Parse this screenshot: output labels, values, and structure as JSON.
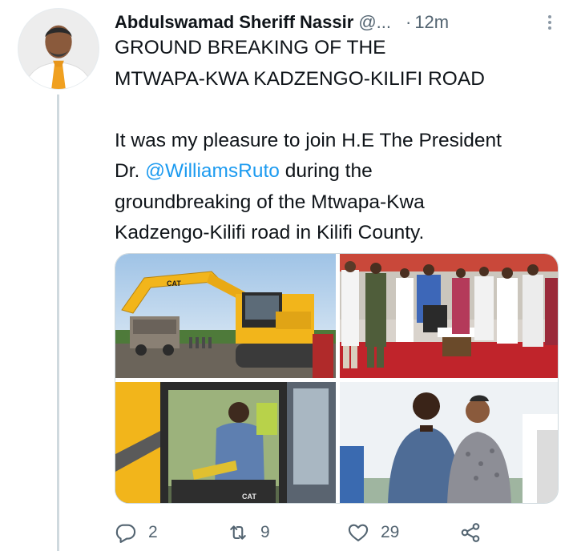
{
  "tweet": {
    "author_name": "Abdulswamad Sheriff Nassir",
    "author_handle": "@...",
    "separator": "·",
    "time": "12m",
    "title_line1": "GROUND BREAKING OF THE",
    "title_line2": "MTWAPA-KWA KADZENGO-KILIFI ROAD",
    "body_line1": "It was my pleasure to join H.E The President",
    "body_line2_pre": "Dr. ",
    "body_mention": "@WilliamsRuto",
    "body_line2_post": " during the",
    "body_line3": "groundbreaking of the Mtwapa-Kwa",
    "body_line4": "Kadzengo-Kilifi road in Kilifi County.",
    "photo_brand_label": "CAT"
  },
  "actions": {
    "replies": "2",
    "retweets": "9",
    "likes": "29"
  },
  "icons": {
    "more": "more-vertical-icon",
    "reply": "reply-icon",
    "retweet": "retweet-icon",
    "like": "heart-icon",
    "share": "share-icon"
  },
  "colors": {
    "accent": "#1d9bf0",
    "muted": "#536471",
    "text": "#0f1419",
    "thread_line": "#cfd9de",
    "excavator_yellow": "#f2b51b",
    "carpet_red": "#c0242b"
  }
}
